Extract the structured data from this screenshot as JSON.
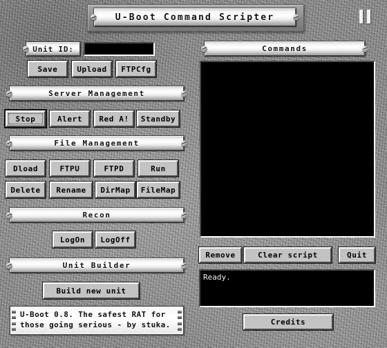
{
  "window": {
    "title": "U-Boot Command Scripter",
    "pause_icon": "pause-icon"
  },
  "left_panel": {
    "unit_id": {
      "label": "Unit ID:",
      "value": "",
      "placeholder": ""
    },
    "top_buttons": [
      {
        "label": "Save"
      },
      {
        "label": "Upload"
      },
      {
        "label": "FTPCfg"
      }
    ],
    "server_management": {
      "header": "Server Management",
      "buttons": [
        {
          "label": "Stop",
          "default": true
        },
        {
          "label": "Alert",
          "default": false
        },
        {
          "label": "Red A!",
          "default": false
        },
        {
          "label": "Standby",
          "default": false
        }
      ]
    },
    "file_management": {
      "header": "File Management",
      "row1": [
        {
          "label": "Dload"
        },
        {
          "label": "FTPU"
        },
        {
          "label": "FTPD"
        },
        {
          "label": "Run"
        }
      ],
      "row2": [
        {
          "label": "Delete"
        },
        {
          "label": "Rename"
        },
        {
          "label": "DirMap"
        },
        {
          "label": "FileMap"
        }
      ]
    },
    "recon": {
      "header": "Recon",
      "buttons": [
        {
          "label": "LogOn"
        },
        {
          "label": "LogOff"
        }
      ]
    },
    "unit_builder": {
      "header": "Unit Builder",
      "button": "Build new unit"
    },
    "info_line1": "U-Boot 0.8. The safest RAT for",
    "info_line2": "those going serious - by stuka."
  },
  "right_panel": {
    "commands": {
      "header": "Commands",
      "items": []
    },
    "action_buttons": [
      {
        "label": "Remove"
      },
      {
        "label": "Clear script"
      },
      {
        "label": "Quit"
      }
    ],
    "status": {
      "text": "Ready."
    },
    "credits_button": "Credits"
  },
  "colors": {
    "button_face": "#c3c3c3",
    "field_background": "#000000",
    "field_text": "#f0f0f0",
    "plate_text": "#111111"
  }
}
